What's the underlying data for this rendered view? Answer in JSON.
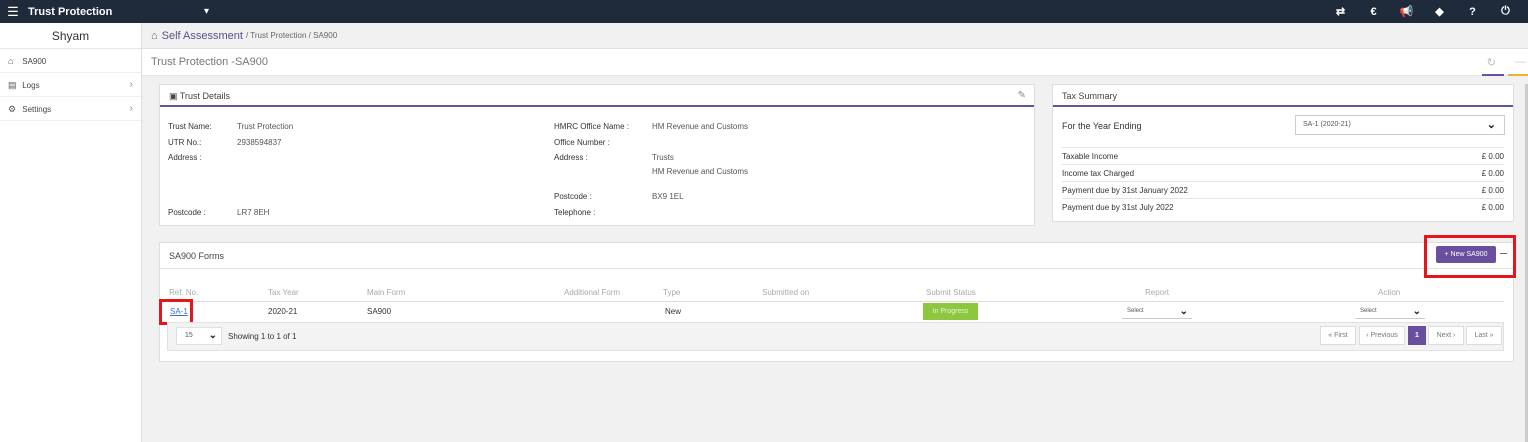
{
  "topbar": {
    "menu_icon": "menu-icon",
    "title": "Trust Protection",
    "dropdown_icon": "chevron-down-icon",
    "right_icons": [
      "transfer-icon",
      "currency-icon",
      "megaphone-icon",
      "tag-icon",
      "help-icon",
      "power-icon"
    ],
    "right_glyphs": [
      "⇄",
      "€",
      "📢",
      "◆",
      "?",
      "⏻"
    ]
  },
  "sidebar": {
    "user": "Shyam",
    "items": [
      {
        "label": "SA900",
        "icon": "home-icon",
        "glyph": "⌂",
        "arrow": ""
      },
      {
        "label": "Logs",
        "icon": "file-icon",
        "glyph": "▤",
        "arrow": "›"
      },
      {
        "label": "Settings",
        "icon": "gear-icon",
        "glyph": "⚙",
        "arrow": "›"
      }
    ]
  },
  "breadcrumb": {
    "home": "Self Assessment",
    "rest": "/ Trust Protection / SA900"
  },
  "page": {
    "title": "Trust Protection -SA900"
  },
  "trust_details": {
    "heading": "Trust Details",
    "trust_name_label": "Trust Name:",
    "trust_name": "Trust Protection",
    "utr_label": "UTR No.:",
    "utr": "2938594837",
    "address_label": "Address :",
    "postcode_label": "Postcode :",
    "postcode": "LR7 8EH",
    "hmrc_office_label": "HMRC Office Name :",
    "hmrc_office": "HM Revenue and Customs",
    "office_number_label": "Office Number :",
    "office_address_label": "Address :",
    "office_address_1": "Trusts",
    "office_address_2": "HM Revenue and Customs",
    "office_postcode_label": "Postcode :",
    "office_postcode": "BX9 1EL",
    "telephone_label": "Telephone :"
  },
  "tax_summary": {
    "heading": "Tax Summary",
    "year_label": "For the Year Ending",
    "year_value": "SA-1 (2020-21)",
    "rows": [
      {
        "label": "Taxable Income",
        "amount": "£ 0.00"
      },
      {
        "label": "Income tax Charged",
        "amount": "£ 0.00"
      },
      {
        "label": "Payment due by 31st January 2022",
        "amount": "£ 0.00"
      },
      {
        "label": "Payment due by 31st July 2022",
        "amount": "£ 0.00"
      }
    ]
  },
  "forms": {
    "heading": "SA900 Forms",
    "new_button": "+ New SA900",
    "collapse": "–",
    "columns": [
      "Ref. No.",
      "Tax Year",
      "Main Form",
      "Additional Form",
      "Type",
      "Submitted on",
      "Submit Status",
      "Report",
      "Action"
    ],
    "row": {
      "ref": "SA-1",
      "tax_year": "2020-21",
      "main_form": "SA900",
      "additional_form": "",
      "type": "New",
      "submitted_on": "",
      "status": "In Progress",
      "report": "Select",
      "action": "Select"
    },
    "per_page": "15",
    "showing": "Showing 1 to 1 of 1",
    "pagination": [
      "« First",
      "‹ Previous",
      "1",
      "Next ›",
      "Last »"
    ]
  }
}
